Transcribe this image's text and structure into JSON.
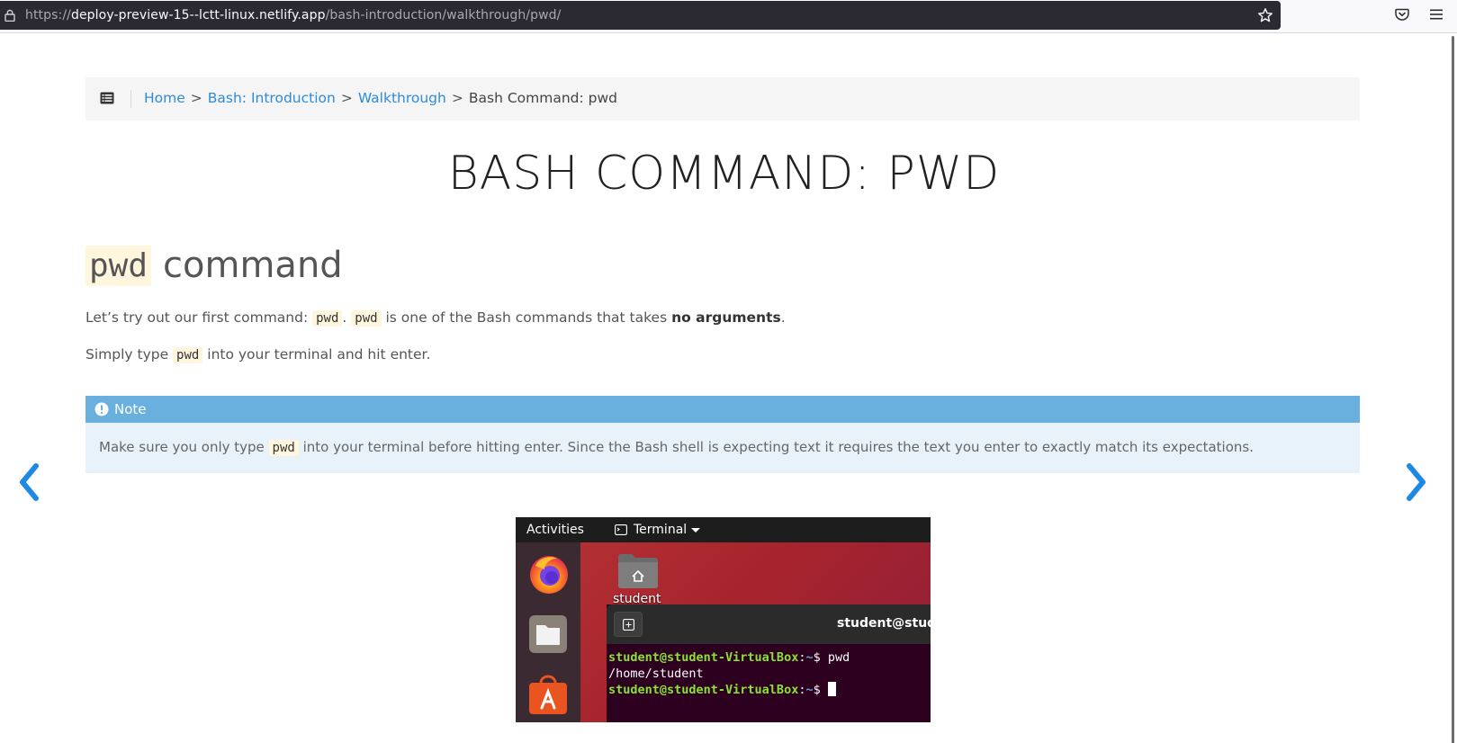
{
  "browser": {
    "url_prefix": "https://",
    "url_host": "deploy-preview-15--lctt-linux.netlify.app",
    "url_path": "/bash-introduction/walkthrough/pwd/"
  },
  "breadcrumb": {
    "items": [
      "Home",
      "Bash: Introduction",
      "Walkthrough"
    ],
    "separator": ">",
    "current": "Bash Command: pwd"
  },
  "page": {
    "title": "BASH COMMAND: PWD",
    "heading_code": "pwd",
    "heading_text": "command",
    "para1": {
      "text_a": "Let’s try out our first command: ",
      "code_a": "pwd",
      "text_b": ". ",
      "code_b": "pwd",
      "text_c": " is one of the Bash commands that takes ",
      "bold": "no arguments",
      "text_d": "."
    },
    "para2": {
      "text_a": "Simply type ",
      "code": "pwd",
      "text_b": " into your terminal and hit enter."
    },
    "note": {
      "title": "Note",
      "text_a": "Make sure you only type ",
      "code": "pwd",
      "text_b": " into your terminal before hitting enter. Since the Bash shell is expecting text it requires the text you enter to exactly match its expectations."
    }
  },
  "screenshot": {
    "activities": "Activities",
    "app_menu": "Terminal",
    "home_label": "student",
    "terminal_title": "student@student-VirtualBox: ~",
    "line1_user": "student@student-VirtualBox",
    "line1_colon": ":",
    "line1_path": "~",
    "line1_cmd": "$ pwd",
    "line2": "/home/student",
    "line3_user": "student@student-VirtualBox",
    "line3_colon": ":",
    "line3_path": "~",
    "line3_prompt": "$ "
  },
  "colors": {
    "link": "#2e8bd8",
    "note_header": "#6ab0de",
    "note_body": "#e7f2fa",
    "nav_arrow": "#1e88e5",
    "code_bg": "#fff6dd"
  }
}
